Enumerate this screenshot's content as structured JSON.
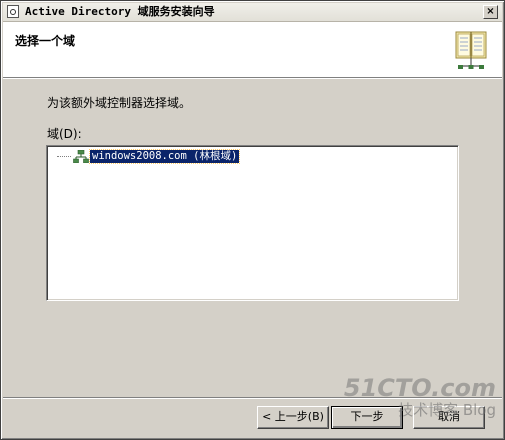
{
  "window": {
    "title": "Active Directory 域服务安装向导",
    "close_glyph": "×"
  },
  "header": {
    "title": "选择一个域",
    "icon": "book-icon"
  },
  "content": {
    "instruction": "为该额外域控制器选择域。",
    "domain_label": "域(D):",
    "tree_items": [
      {
        "label": "windows2008.com (林根域)",
        "icon": "domain-tree-icon",
        "selected": true
      }
    ]
  },
  "buttons": {
    "back": "< 上一步(B)",
    "next": "下一步",
    "cancel": "取消"
  },
  "watermark": {
    "main": "51CTO.com",
    "sub": "技术博客 Blog"
  },
  "colors": {
    "selection": "#0a246a",
    "dialog_bg": "#d4d0c8"
  }
}
